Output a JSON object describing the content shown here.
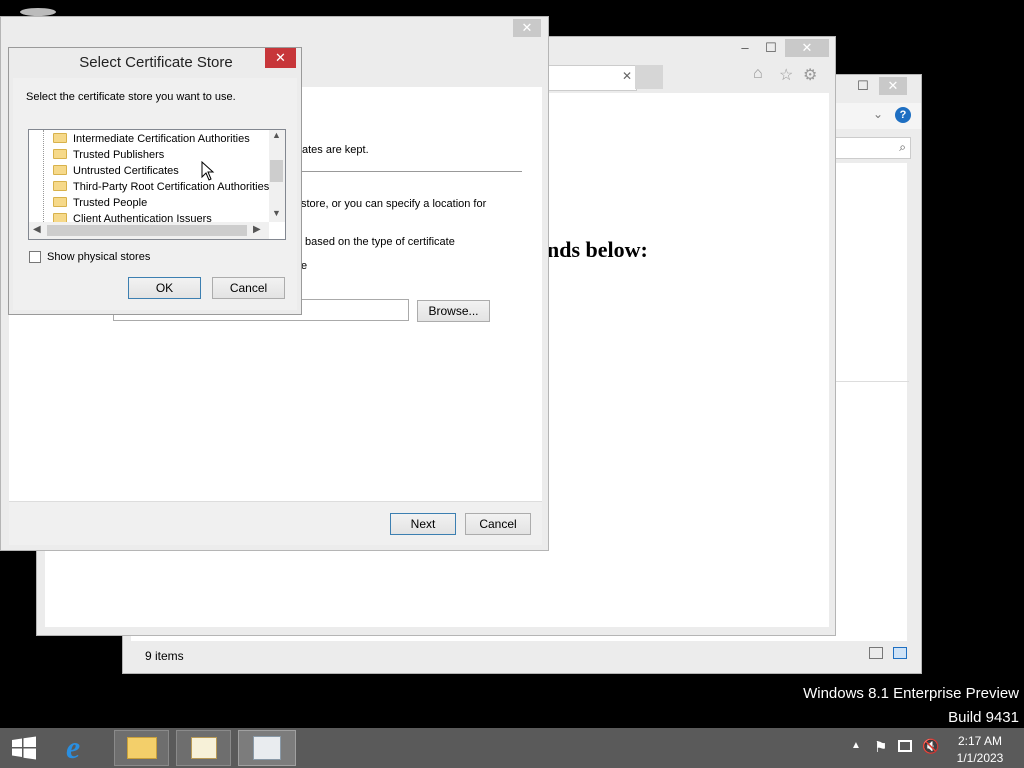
{
  "explorer": {
    "status_items": "9 items"
  },
  "browser": {
    "heading_fragment": "nds below:"
  },
  "wizard": {
    "text1": "ficates are kept.",
    "text2": "store, or you can specify a location for",
    "text3": "based on the type of certificate",
    "text4": "e",
    "browse_label": "Browse...",
    "next_label": "Next",
    "cancel_label": "Cancel"
  },
  "dialog": {
    "title": "Select Certificate Store",
    "instruction": "Select the certificate store you want to use.",
    "tree_items": [
      "Intermediate Certification Authorities",
      "Trusted Publishers",
      "Untrusted Certificates",
      "Third-Party Root Certification Authorities",
      "Trusted People",
      "Client Authentication Issuers"
    ],
    "show_physical_label": "Show physical stores",
    "ok_label": "OK",
    "cancel_label": "Cancel"
  },
  "desktop": {
    "watermark_line1": "Windows 8.1 Enterprise Preview",
    "watermark_line2": "Build 9431"
  },
  "taskbar": {
    "time": "2:17 AM",
    "date": "1/1/2023",
    "icons": [
      "start-icon",
      "internet-explorer-icon",
      "file-explorer-icon",
      "certificate-icon",
      "certificate-import-icon"
    ]
  },
  "colors": {
    "close_red": "#c7363a",
    "taskbar": "#5a5a5a",
    "accent_blue": "#1e6fc2"
  }
}
